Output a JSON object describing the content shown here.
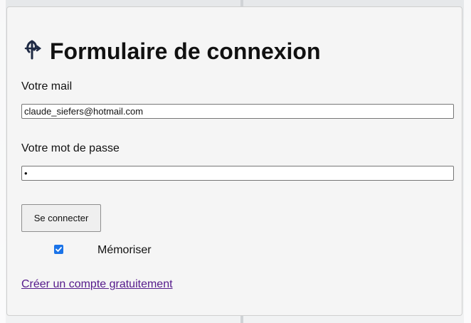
{
  "page": {
    "title": "Formulaire de connexion",
    "logo_icon": "arrow-swirl-logo-icon"
  },
  "form": {
    "email_label": "Votre mail",
    "email_value": "claude_siefers@hotmail.com",
    "password_label": "Votre mot de passe",
    "password_value": "•",
    "submit_label": "Se connecter",
    "remember_label": "Mémoriser",
    "remember_checked": true,
    "signup_link": "Créer un compte gratuitement"
  },
  "colors": {
    "panel_bg": "#f5f5f5",
    "checkbox_accent": "#1a73e8",
    "visited_link": "#551a8b",
    "logo": "#1f2a44"
  }
}
